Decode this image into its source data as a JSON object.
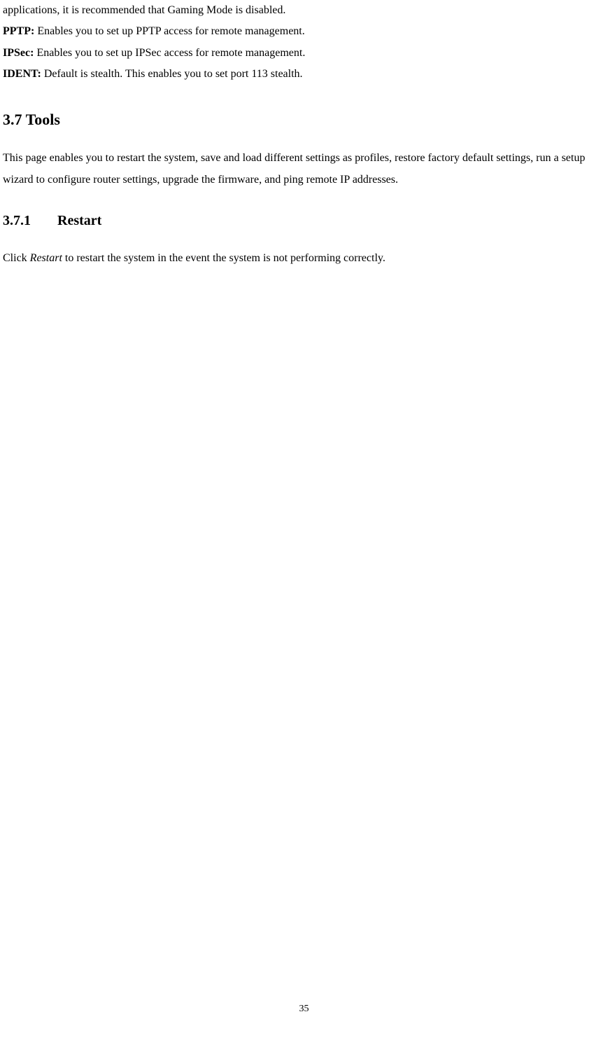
{
  "topFragment": "applications, it is recommended that Gaming Mode is disabled.",
  "defs": [
    {
      "label": "PPTP:",
      "text": " Enables you to set up PPTP access for remote management."
    },
    {
      "label": "IPSec:",
      "text": " Enables you to set up IPSec access for remote management."
    },
    {
      "label": "IDENT:",
      "text": " Default is stealth.    This enables you to set port 113 stealth."
    }
  ],
  "section": {
    "heading": "3.7 Tools",
    "intro": "This page enables you to restart the system, save and load different settings as profiles, restore factory default settings, run a setup wizard to configure router settings, upgrade the firmware, and ping remote IP addresses."
  },
  "subsection": {
    "num": "3.7.1",
    "title": "Restart",
    "textBefore": "Click ",
    "italic": "Restart",
    "textAfter": " to restart the system in the event the system is not performing correctly."
  },
  "pageNumber": "35"
}
